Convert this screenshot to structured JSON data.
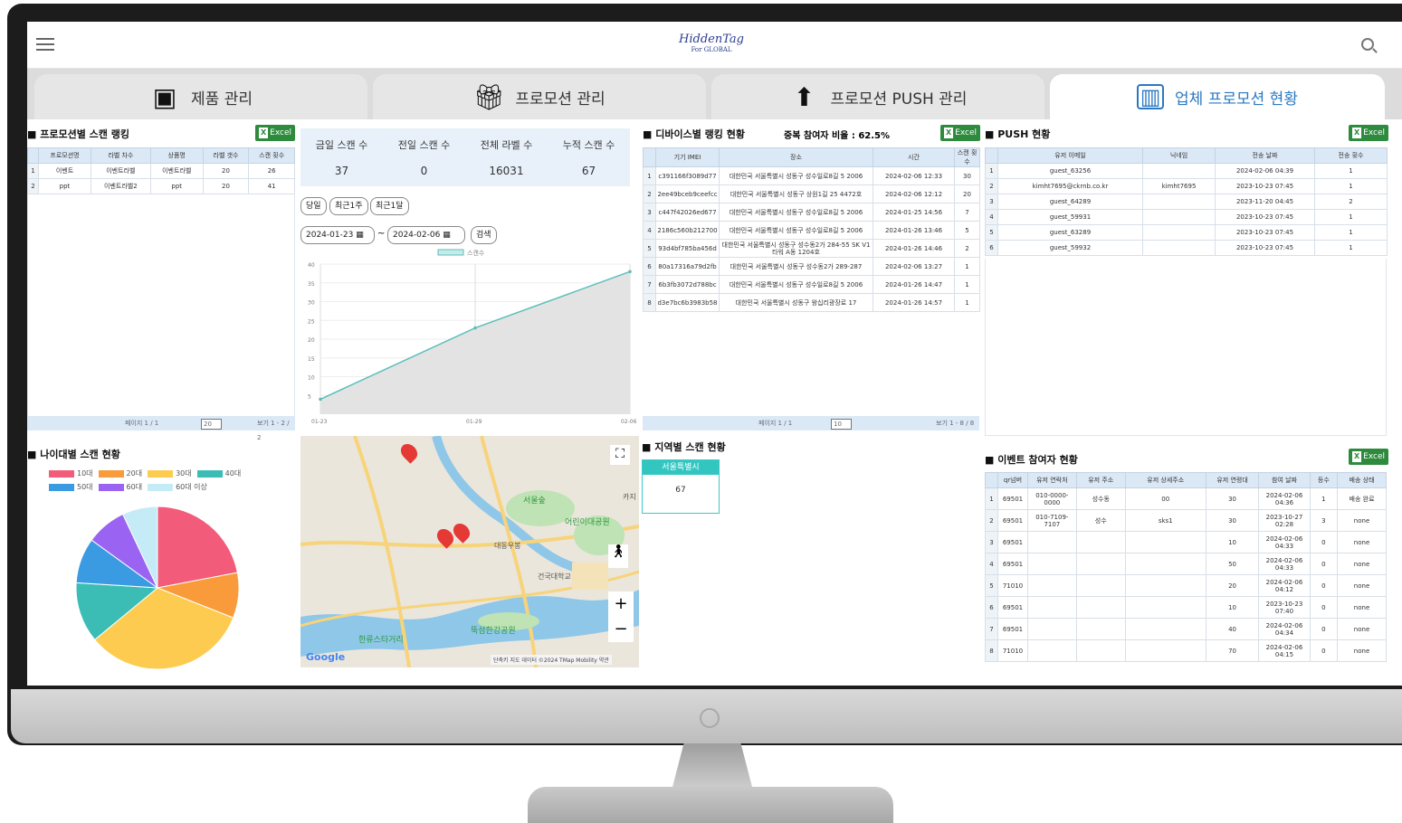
{
  "app": {
    "logo_main": "HiddenTag",
    "logo_sub": "For GLOBAL"
  },
  "tabs": [
    {
      "label": "제품 관리",
      "icon": "box-icon"
    },
    {
      "label": "프로모션 관리",
      "icon": "gift-icon"
    },
    {
      "label": "프로모션 PUSH 관리",
      "icon": "upload-icon"
    },
    {
      "label": "업체 프로모션 현황",
      "icon": "report-chart-icon",
      "active": true
    }
  ],
  "excel_label": "Excel",
  "promo_ranking": {
    "title": "프로모션별 스캔 랭킹",
    "columns": [
      "",
      "프로모션명",
      "라벨 차수",
      "상품명",
      "라벨 갯수",
      "스캔 횟수"
    ],
    "rows": [
      [
        "1",
        "이벤트",
        "이벤트라벨",
        "이벤트라벨",
        "20",
        "26"
      ],
      [
        "2",
        "ppt",
        "이벤트라벨2",
        "ppt",
        "20",
        "41"
      ]
    ],
    "pager_text": "페이지 1 / 1",
    "page_size": "20",
    "count_text": "보기 1 - 2 / 2"
  },
  "stats": [
    {
      "label": "금일 스캔 수",
      "value": "37"
    },
    {
      "label": "전일 스캔 수",
      "value": "0"
    },
    {
      "label": "전체 라벨 수",
      "value": "16031"
    },
    {
      "label": "누적 스캔 수",
      "value": "67"
    }
  ],
  "filters": {
    "buttons": [
      "당일",
      "최근1주",
      "최근1달"
    ],
    "date_from": "2024-01-23",
    "date_to": "2024-02-06",
    "search_label": "검색",
    "tilde": "~"
  },
  "chart_data": {
    "type": "line",
    "legend": [
      "스캔수"
    ],
    "x": [
      "01-23",
      "01-29",
      "02-06"
    ],
    "y_ticks": [
      5,
      10,
      15,
      20,
      25,
      30,
      35,
      40
    ],
    "ylim": [
      0,
      40
    ],
    "series": [
      {
        "name": "스캔수",
        "points": [
          [
            0,
            4
          ],
          [
            1,
            23
          ],
          [
            2,
            38
          ]
        ]
      }
    ]
  },
  "device_ranking": {
    "title": "디바이스별 랭킹 현황",
    "ratio_text": "중복 참여자 비율 : 62.5%",
    "columns": [
      "",
      "기기 IMEI",
      "장소",
      "시간",
      "스캔 횟수"
    ],
    "rows": [
      [
        "1",
        "c391166f3089d77",
        "대한민국 서울특별시 성동구 성수일로8길 5 2006",
        "2024-02-06 12:33",
        "30"
      ],
      [
        "2",
        "2ee49bceb9ceefcc",
        "대한민국 서울특별시 성동구 상원1길 25 4472호",
        "2024-02-06 12:12",
        "20"
      ],
      [
        "3",
        "c447f42026ed677",
        "대한민국 서울특별시 성동구 성수일로8길 5 2006",
        "2024-01-25 14:56",
        "7"
      ],
      [
        "4",
        "2186c560b212700",
        "대한민국 서울특별시 성동구 성수일로8길 5 2006",
        "2024-01-26 13:46",
        "5"
      ],
      [
        "5",
        "93d4bf785ba456d",
        "대한민국 서울특별시 성동구 성수동2가 284-55 SK V1타워 A동 1204호",
        "2024-01-26 14:46",
        "2"
      ],
      [
        "6",
        "80a17316a79d2fb",
        "대한민국 서울특별시 성동구 성수동2가 289-287",
        "2024-02-06 13:27",
        "1"
      ],
      [
        "7",
        "6b3fb3072d788bc",
        "대한민국 서울특별시 성동구 성수일로8길 5 2006",
        "2024-01-26 14:47",
        "1"
      ],
      [
        "8",
        "d3e7bc6b3983b58",
        "대한민국 서울특별시 성동구 왕십리광장로 17",
        "2024-01-26 14:57",
        "1"
      ]
    ],
    "pager_text": "페이지 1 / 1",
    "page_size": "10",
    "count_text": "보기 1 - 8 / 8"
  },
  "push_status": {
    "title": "PUSH 현황",
    "columns": [
      "",
      "유저 이메일",
      "닉네임",
      "전송 날짜",
      "전송 횟수"
    ],
    "rows": [
      [
        "1",
        "guest_63256",
        "",
        "2024-02-06 04:39",
        "1"
      ],
      [
        "2",
        "kimht7695@ckrnb.co.kr",
        "kimht7695",
        "2023-10-23 07:45",
        "1"
      ],
      [
        "3",
        "guest_64289",
        "",
        "2023-11-20 04:45",
        "2"
      ],
      [
        "4",
        "guest_59931",
        "",
        "2023-10-23 07:45",
        "1"
      ],
      [
        "5",
        "guest_63289",
        "",
        "2023-10-23 07:45",
        "1"
      ],
      [
        "6",
        "guest_59932",
        "",
        "2023-10-23 07:45",
        "1"
      ]
    ]
  },
  "age_chart": {
    "title": "나이대별 스캔 현황",
    "legend": [
      {
        "label": "10대",
        "color": "#f25c7a"
      },
      {
        "label": "20대",
        "color": "#f99b3a"
      },
      {
        "label": "30대",
        "color": "#fccb50"
      },
      {
        "label": "40대",
        "color": "#3bbdb6"
      },
      {
        "label": "50대",
        "color": "#3a9be3"
      },
      {
        "label": "60대",
        "color": "#9b63f2"
      },
      {
        "label": "60대 이상",
        "color": "#c5ebf7"
      }
    ],
    "values": [
      22,
      9,
      33,
      12,
      9,
      8,
      7
    ]
  },
  "map": {
    "labels": [
      "서울숲",
      "어린이대공원",
      "뚝섬한강공원",
      "건국대학교",
      "한류스타거리",
      "대동우봉",
      "카지"
    ],
    "footer": "단축키  지도 데이터 ©2024 TMap Mobility  약관",
    "google": "Google"
  },
  "region": {
    "title": "지역별 스캔 현황",
    "region": "서울특별시",
    "value": "67"
  },
  "event": {
    "title": "이벤트 참여자 현황",
    "columns": [
      "",
      "qr넘버",
      "유저 연락처",
      "유저 주소",
      "유저 상세주소",
      "유저 연령대",
      "참여 날짜",
      "등수",
      "배송 상태"
    ],
    "rows": [
      [
        "1",
        "69501",
        "010-0000-0000",
        "성수동",
        "00",
        "30",
        "2024-02-06 04:36",
        "1",
        "배송 완료"
      ],
      [
        "2",
        "69501",
        "010-7109-7107",
        "성수",
        "sks1",
        "30",
        "2023-10-27 02:28",
        "3",
        "none"
      ],
      [
        "3",
        "69501",
        "",
        "",
        "",
        "10",
        "2024-02-06 04:33",
        "0",
        "none"
      ],
      [
        "4",
        "69501",
        "",
        "",
        "",
        "50",
        "2024-02-06 04:33",
        "0",
        "none"
      ],
      [
        "5",
        "71010",
        "",
        "",
        "",
        "20",
        "2024-02-06 04:12",
        "0",
        "none"
      ],
      [
        "6",
        "69501",
        "",
        "",
        "",
        "10",
        "2023-10-23 07:40",
        "0",
        "none"
      ],
      [
        "7",
        "69501",
        "",
        "",
        "",
        "40",
        "2024-02-06 04:34",
        "0",
        "none"
      ],
      [
        "8",
        "71010",
        "",
        "",
        "",
        "70",
        "2024-02-06 04:15",
        "0",
        "none"
      ]
    ]
  }
}
